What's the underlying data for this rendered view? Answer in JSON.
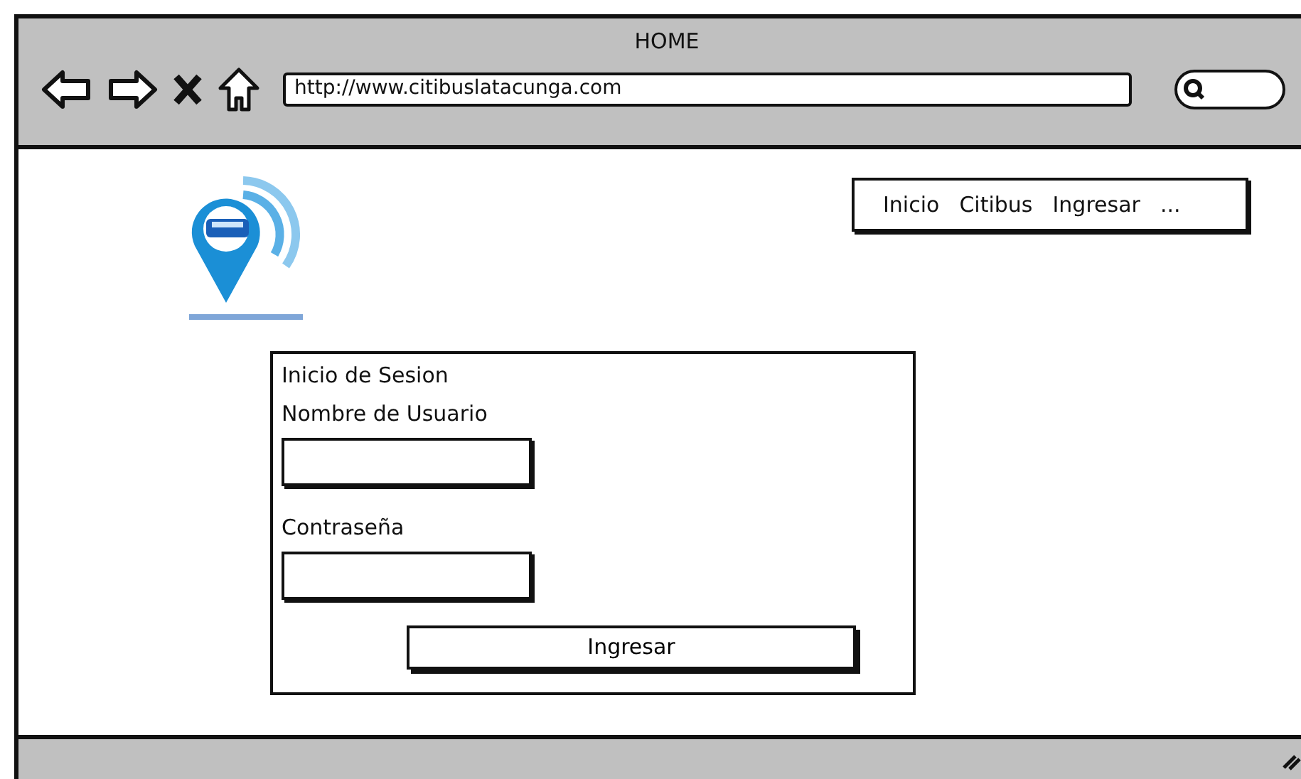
{
  "window": {
    "title": "HOME"
  },
  "browser": {
    "url": "http://www.citibuslatacunga.com"
  },
  "nav": [
    {
      "label": "Inicio"
    },
    {
      "label": "Citibus"
    },
    {
      "label": "Ingresar"
    },
    {
      "label": "..."
    }
  ],
  "login": {
    "title": "Inicio de Sesion",
    "fields": [
      {
        "label": "Nombre de Usuario"
      },
      {
        "label": "Contraseña"
      }
    ],
    "button": "Ingresar"
  }
}
